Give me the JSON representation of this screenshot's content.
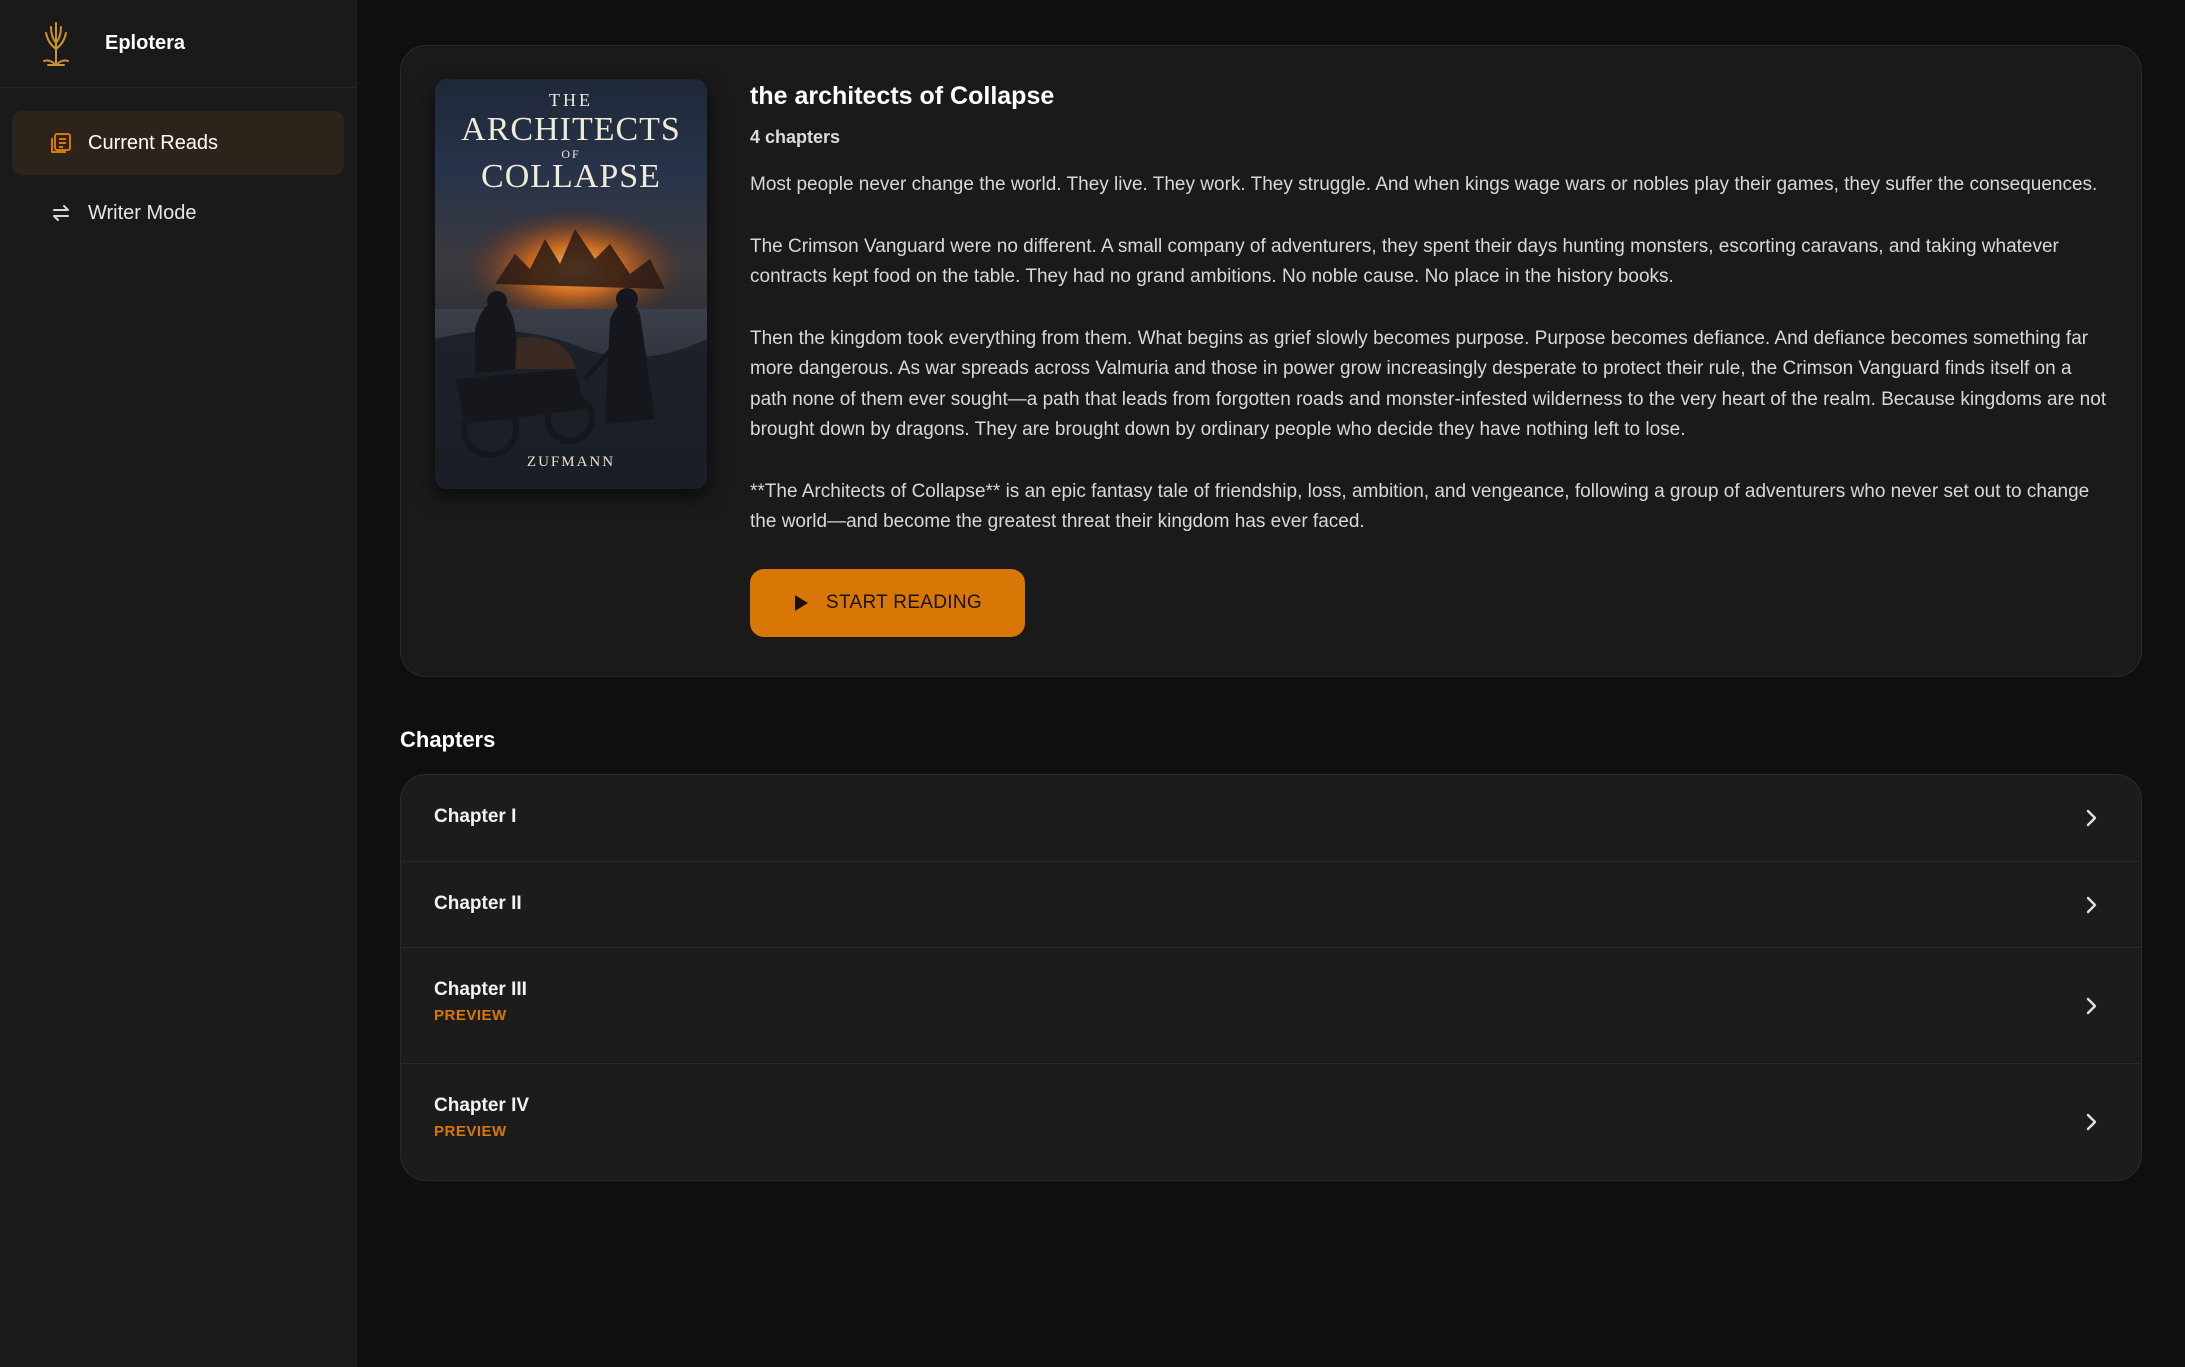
{
  "app": {
    "name": "Eplotera",
    "accent": "#d97706"
  },
  "sidebar": {
    "items": [
      {
        "label": "Current Reads",
        "icon": "book-icon",
        "active": true
      },
      {
        "label": "Writer Mode",
        "icon": "swap-arrows-icon",
        "active": false
      }
    ]
  },
  "book": {
    "title": "the architects of Collapse",
    "chapters_count": "4 chapters",
    "cover": {
      "line1": "THE",
      "line2": "ARCHITECTS",
      "line3": "OF",
      "line4": "COLLAPSE",
      "author": "ZUFMANN"
    },
    "description": [
      "Most people never change the world. They live. They work. They struggle. And when kings wage wars or nobles play their games, they suffer the consequences.",
      "The Crimson Vanguard were no different. A small company of adventurers, they spent their days hunting monsters, escorting caravans, and taking whatever contracts kept food on the table. They had no grand ambitions. No noble cause. No place in the history books.",
      "Then the kingdom took everything from them. What begins as grief slowly becomes purpose. Purpose becomes defiance. And defiance becomes something far more dangerous. As war spreads across Valmuria and those in power grow increasingly desperate to protect their rule, the Crimson Vanguard finds itself on a path none of them ever sought—a path that leads from forgotten roads and monster-infested wilderness to the very heart of the realm. Because kingdoms are not brought down by dragons. They are brought down by ordinary people who decide they have nothing left to lose.",
      "**The Architects of Collapse** is an epic fantasy tale of friendship, loss, ambition, and vengeance, following a group of adventurers who never set out to change the world—and become the greatest threat their kingdom has ever faced."
    ],
    "start_button": "START READING"
  },
  "chapters_section": {
    "title": "Chapters",
    "items": [
      {
        "name": "Chapter I",
        "badge": ""
      },
      {
        "name": "Chapter II",
        "badge": ""
      },
      {
        "name": "Chapter III",
        "badge": "PREVIEW"
      },
      {
        "name": "Chapter IV",
        "badge": "PREVIEW"
      }
    ]
  }
}
